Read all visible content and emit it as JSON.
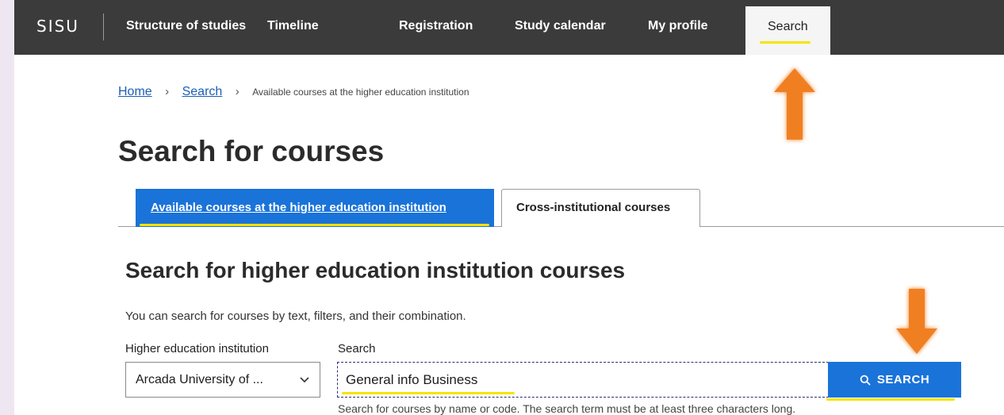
{
  "nav": {
    "brand": "SISU",
    "items": [
      {
        "label": "Structure of studies"
      },
      {
        "label": "Timeline"
      },
      {
        "label": "Registration"
      },
      {
        "label": "Study calendar"
      },
      {
        "label": "My profile"
      },
      {
        "label": "Search",
        "active": true
      }
    ]
  },
  "breadcrumb": {
    "home": "Home",
    "search": "Search",
    "current": "Available courses at the higher education institution"
  },
  "page_title": "Search for courses",
  "tabs": [
    {
      "label": "Available courses at the higher education institution",
      "active": true
    },
    {
      "label": "Cross-institutional courses",
      "active": false
    }
  ],
  "section": {
    "title": "Search for higher education institution courses",
    "intro": "You can search for courses by text, filters, and their combination."
  },
  "form": {
    "institution_label": "Higher education institution",
    "institution_value": "Arcada University of ...",
    "search_label": "Search",
    "search_value": "General info Business",
    "search_button": "SEARCH",
    "hint": "Search for courses by name or code. The search term must be at least three characters long."
  },
  "colors": {
    "nav_bg": "#3b3b3b",
    "accent_blue": "#1a73d9",
    "link_blue": "#1a5fb4",
    "highlight_yellow": "#f5e400",
    "annotation_orange": "#f07f22"
  },
  "icons": [
    "chevron-down-icon",
    "search-icon",
    "annotation-arrow-up-icon",
    "annotation-arrow-down-icon"
  ]
}
